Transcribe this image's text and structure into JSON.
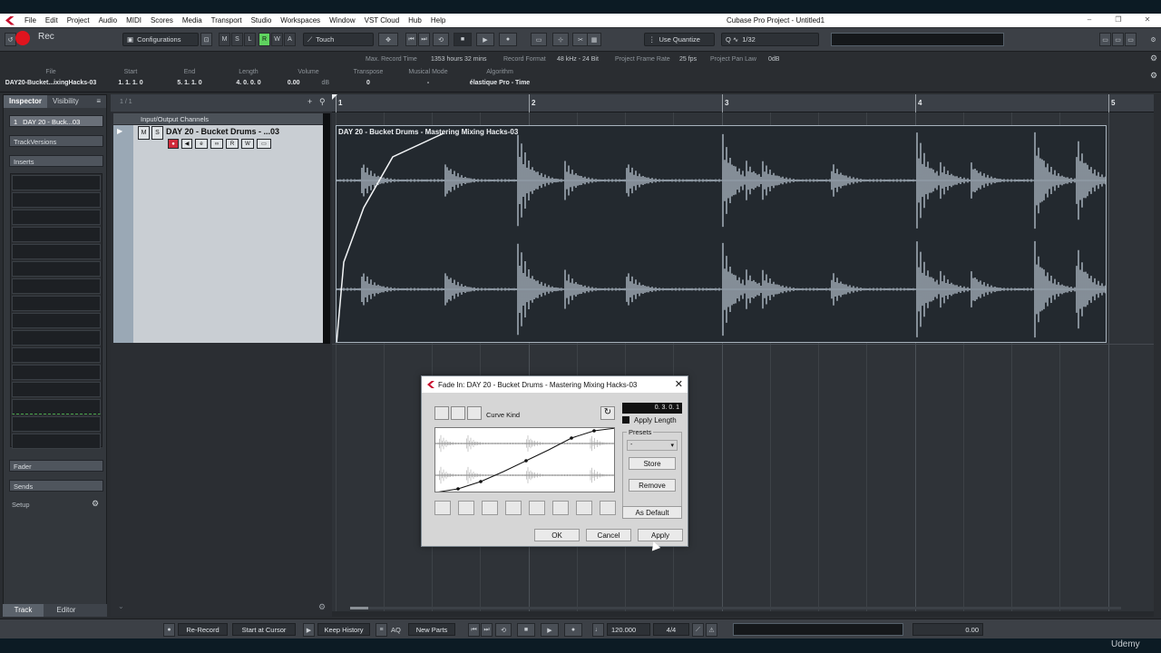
{
  "menubar": {
    "items": [
      "File",
      "Edit",
      "Project",
      "Audio",
      "MIDI",
      "Scores",
      "Media",
      "Transport",
      "Studio",
      "Workspaces",
      "Window",
      "VST Cloud",
      "Hub",
      "Help"
    ],
    "window_title": "Cubase Pro Project - Untitled1"
  },
  "toolbar": {
    "rec_label": "Rec",
    "configurations": "Configurations",
    "mute": "M",
    "solo": "S",
    "listen": "L",
    "read": "R",
    "write": "W",
    "a": "A",
    "automation_mode": "Touch",
    "quantize_mode": "Use Quantize",
    "quantize_value": "1/32"
  },
  "infoline": {
    "max_record_time_label": "Max. Record Time",
    "max_record_time": "1353 hours 32 mins",
    "record_format_label": "Record Format",
    "record_format": "48 kHz - 24 Bit",
    "frame_rate_label": "Project Frame Rate",
    "frame_rate": "25 fps",
    "pan_law_label": "Project Pan Law",
    "pan_law": "0dB"
  },
  "eventinfo": {
    "file": {
      "h": "File",
      "v": "DAY20-Bucket...ixingHacks-03"
    },
    "start": {
      "h": "Start",
      "v": "1. 1. 1.   0"
    },
    "end": {
      "h": "End",
      "v": "5. 1. 1.   0"
    },
    "length": {
      "h": "Length",
      "v": "4. 0. 0.   0"
    },
    "volume": {
      "h": "Volume",
      "v": "0.00",
      "unit": "dB"
    },
    "transpose": {
      "h": "Transpose",
      "v": "0"
    },
    "musical_mode": {
      "h": "Musical Mode",
      "v": "-"
    },
    "algorithm": {
      "h": "Algorithm",
      "v": "élastique Pro - Time"
    }
  },
  "inspector": {
    "tab_inspector": "Inspector",
    "tab_visibility": "Visibility",
    "track_name": "DAY 20 - Buck...03",
    "track_number": "1",
    "track_versions": "TrackVersions",
    "inserts": "Inserts",
    "fader": "Fader",
    "sends": "Sends",
    "setup": "Setup",
    "bottom_tab_track": "Track",
    "bottom_tab_editor": "Editor"
  },
  "tracklist": {
    "count": "1 / 1",
    "folder": "Input/Output Channels",
    "track_name": "DAY 20 - Bucket Drums - ...03",
    "m": "M",
    "s": "S"
  },
  "ruler": {
    "bars": [
      "1",
      "2",
      "3",
      "4",
      "5"
    ]
  },
  "event": {
    "title": "DAY 20 - Bucket Drums - Mastering Mixing Hacks-03"
  },
  "dialog": {
    "title": "Fade In: DAY 20 - Bucket Drums - Mastering Mixing Hacks-03",
    "curve_kind": "Curve Kind",
    "length_value": "0. 3. 0.   1",
    "apply_length": "Apply Length",
    "presets": "Presets",
    "preset_value": "-",
    "store": "Store",
    "remove": "Remove",
    "as_default": "As Default",
    "ok": "OK",
    "cancel": "Cancel",
    "apply": "Apply"
  },
  "transport": {
    "re_record": "Re-Record",
    "start_at_cursor": "Start at Cursor",
    "keep_history": "Keep History",
    "aq": "AQ",
    "new_parts": "New Parts",
    "tempo": "120.000",
    "signature": "4/4",
    "level": "0.00"
  },
  "watermark": "Udemy"
}
